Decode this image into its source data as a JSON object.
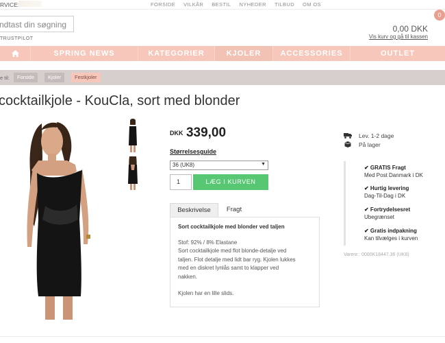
{
  "topbar": {
    "service_label": "RVICE:",
    "nav": [
      "FORSIDE",
      "VILKÅR",
      "BESTIL",
      "NYHEDER",
      "TILBUD",
      "OM OS"
    ]
  },
  "header": {
    "search_placeholder": "ndtast din søgning",
    "trustpilot": "TRUSTPILOT",
    "cart_total": "0,00 DKK",
    "cart_link": "Vis kurv og gå til kassen",
    "cart_count": "0"
  },
  "mainnav": {
    "items": [
      "SPRING NEWS",
      "KATEGORIER",
      "KJOLER",
      "ACCESSORIES",
      "OUTLET"
    ],
    "home_icon": "home-icon"
  },
  "breadcrumb": {
    "label": "e til:",
    "items": [
      "Forside",
      "Kjoler",
      "Festkjoler"
    ]
  },
  "product": {
    "title": "cocktailkjole - KouCla, sort med blonder",
    "currency": "DKK",
    "price": "339,00",
    "size_guide": "Størrelsesguide",
    "size_selected": "36 (UK8)",
    "quantity": "1",
    "add_to_cart": "LÆG I KURVEN",
    "tabs": [
      "Beskrivelse",
      "Fragt"
    ],
    "description_heading": "Sort cocktailkjole med blonder ved taljen",
    "description_lines": [
      "Stof: 92% / 8% Elastane",
      "Sort cocktailkjole med flot blonde-detalje ved",
      "taljen. Flot detalje med lidt bar ryg. Kjolen lukkes",
      "med en diskret lynlås samt to klapper ved",
      "nakken."
    ],
    "description_extra": "Kjolen har en lille slids."
  },
  "delivery": [
    {
      "icon": "truck-icon",
      "text": "Lev. 1-2 dage"
    },
    {
      "icon": "box-icon",
      "text": "På lager"
    }
  ],
  "usps": [
    {
      "title": "✔ GRATIS Fragt",
      "text": "Med Post Danmark i DK"
    },
    {
      "title": "✔ Hurtig levering",
      "text": "Dag-Til-Dag i DK"
    },
    {
      "title": "✔ Fortrydelsesret",
      "text": "Ubegrænset"
    },
    {
      "title": "✔ Gratis indpakning",
      "text": "Kan tilvælges i kurven"
    }
  ],
  "varenr": "Varenr.: 0000K18447.36 (UK8)",
  "colors": {
    "accent": "#f6c7ba",
    "add_to_cart": "#57c773",
    "breadcrumb_bar": "#d7cfcd"
  }
}
